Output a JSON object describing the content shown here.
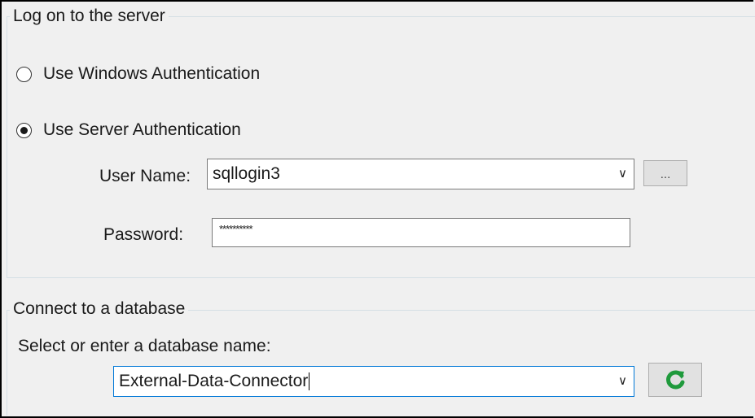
{
  "login_group": {
    "title": "Log on to the server",
    "windows_auth_label": "Use Windows Authentication",
    "server_auth_label": "Use Server Authentication",
    "selected_auth": "server",
    "user_name_label": "User Name:",
    "user_name_value": "sqllogin3",
    "browse_button_label": "...",
    "password_label": "Password:",
    "password_mask": "**********"
  },
  "database_group": {
    "title": "Connect to a database",
    "prompt": "Select or enter a database name:",
    "database_value": "External-Data-Connector",
    "refresh_icon": "refresh-icon"
  },
  "colors": {
    "refresh_green": "#1f9a3c"
  }
}
